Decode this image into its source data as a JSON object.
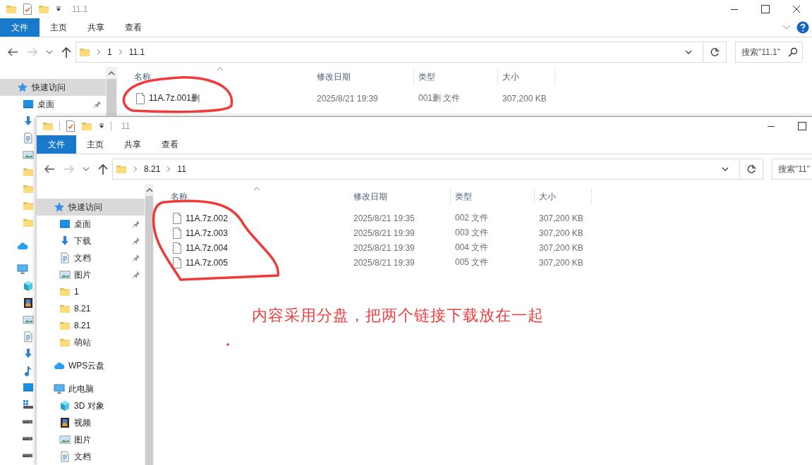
{
  "back_window": {
    "title": "11.1",
    "ribbon_tabs": [
      {
        "label": "文件",
        "selected": true
      },
      {
        "label": "主页",
        "selected": false
      },
      {
        "label": "共享",
        "selected": false
      },
      {
        "label": "查看",
        "selected": false
      }
    ],
    "breadcrumb": [
      "1",
      "11.1"
    ],
    "search": {
      "placeholder": "搜索\"11.1\""
    },
    "nav": [
      {
        "kind": "star",
        "label": "快速访问",
        "selected": true,
        "children": [
          {
            "kind": "desktop",
            "label": "桌面",
            "selected": false,
            "pinned": true
          },
          {
            "kind": "download"
          },
          {
            "kind": "doc"
          },
          {
            "kind": "picture"
          },
          {
            "kind": "folder"
          },
          {
            "kind": "folder"
          },
          {
            "kind": "folder"
          },
          {
            "kind": "folder"
          }
        ]
      },
      {
        "kind": "cloud"
      },
      {
        "kind": "pc",
        "children": [
          {
            "kind": "cube"
          },
          {
            "kind": "film"
          },
          {
            "kind": "picture"
          },
          {
            "kind": "doc"
          },
          {
            "kind": "download"
          },
          {
            "kind": "music"
          },
          {
            "kind": "desktop"
          },
          {
            "kind": "drivewin"
          },
          {
            "kind": "drive"
          },
          {
            "kind": "drive"
          },
          {
            "kind": "drive"
          }
        ]
      }
    ],
    "columns": [
      "名称",
      "修改日期",
      "类型",
      "大小"
    ],
    "rows": [
      {
        "name": "11A.7z.001删",
        "modified": "2025/8/21 19:39",
        "type": "001删 文件",
        "size": "307,200 KB"
      }
    ]
  },
  "front_window": {
    "title": "11",
    "ribbon_tabs": [
      {
        "label": "文件",
        "selected": true
      },
      {
        "label": "主页",
        "selected": false
      },
      {
        "label": "共享",
        "selected": false
      },
      {
        "label": "查看",
        "selected": false
      }
    ],
    "breadcrumb": [
      "8.21",
      "11"
    ],
    "search": {
      "placeholder": "搜索\"11\""
    },
    "nav": [
      {
        "kind": "star",
        "label": "快速访问",
        "selected": true,
        "children": [
          {
            "kind": "desktop",
            "label": "桌面",
            "selected": false,
            "pinned": true
          },
          {
            "kind": "download",
            "label": "下载",
            "selected": false,
            "pinned": true
          },
          {
            "kind": "doc",
            "label": "文档",
            "selected": false,
            "pinned": true
          },
          {
            "kind": "picture",
            "label": "图片",
            "selected": false,
            "pinned": true
          },
          {
            "kind": "folder",
            "label": "1",
            "selected": false,
            "pinned": false
          },
          {
            "kind": "folder",
            "label": "8.21",
            "selected": false,
            "pinned": false
          },
          {
            "kind": "folder",
            "label": "8.21",
            "selected": false,
            "pinned": false
          },
          {
            "kind": "folder",
            "label": "萌站",
            "selected": false,
            "pinned": false
          }
        ]
      },
      {
        "kind": "cloud",
        "label": "WPS云盘",
        "selected": false
      },
      {
        "kind": "pc",
        "label": "此电脑",
        "selected": false,
        "children": [
          {
            "kind": "cube",
            "label": "3D 对象",
            "selected": false
          },
          {
            "kind": "film",
            "label": "视频",
            "selected": false
          },
          {
            "kind": "picture",
            "label": "图片",
            "selected": false
          },
          {
            "kind": "doc",
            "label": "文档",
            "selected": false
          }
        ]
      }
    ],
    "columns": [
      "名称",
      "修改日期",
      "类型",
      "大小"
    ],
    "rows": [
      {
        "name": "11A.7z.002",
        "modified": "2025/8/21 19:35",
        "type": "002 文件",
        "size": "307,200 KB"
      },
      {
        "name": "11A.7z.003",
        "modified": "2025/8/21 19:39",
        "type": "003 文件",
        "size": "307,200 KB"
      },
      {
        "name": "11A.7z.004",
        "modified": "2025/8/21 19:39",
        "type": "004 文件",
        "size": "307,200 KB"
      },
      {
        "name": "11A.7z.005",
        "modified": "2025/8/21 19:39",
        "type": "005 文件",
        "size": "307,200 KB"
      }
    ]
  },
  "annotations": [
    {
      "kind": "circle"
    },
    {
      "kind": "circle"
    },
    {
      "kind": "note",
      "text": "内容采用分盘，把两个链接下载放在一起"
    },
    {
      "kind": "dot"
    }
  ]
}
